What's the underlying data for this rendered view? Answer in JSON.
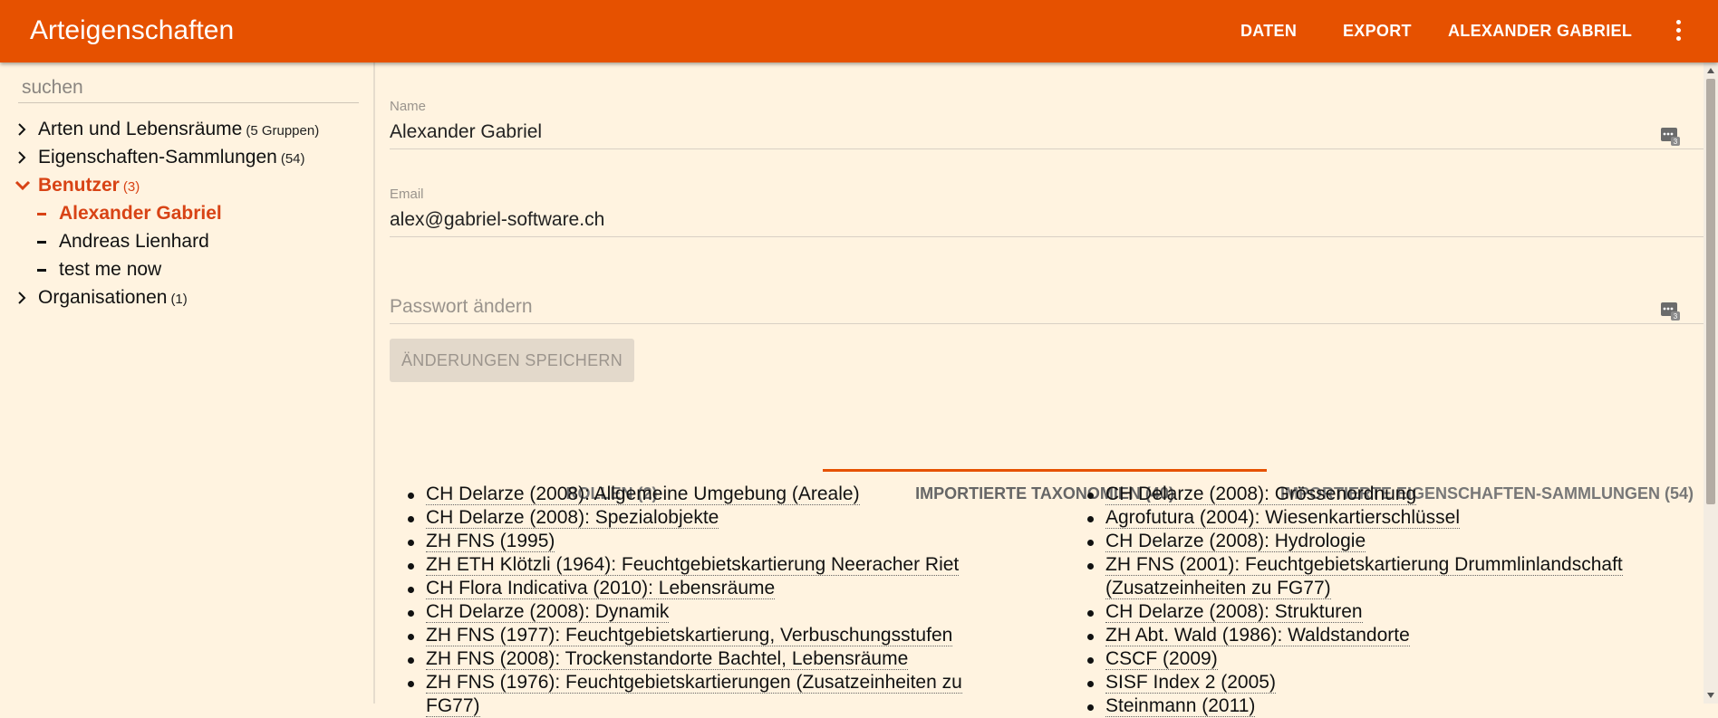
{
  "appbar": {
    "title": "Arteigenschaften",
    "nav": [
      "DATEN",
      "EXPORT",
      "ALEXANDER GABRIEL"
    ],
    "more_icon": "more-vert-icon"
  },
  "sidebar": {
    "search_placeholder": "suchen",
    "tree": [
      {
        "label": "Arten und Lebensräume",
        "count": "(5 Gruppen)",
        "icon": "chevron-right-icon"
      },
      {
        "label": "Eigenschaften-Sammlungen",
        "count": "(54)",
        "icon": "chevron-right-icon"
      },
      {
        "label": "Benutzer",
        "count": "(3)",
        "icon": "chevron-down-icon",
        "active": true
      },
      {
        "label": "Alexander Gabriel",
        "icon": "dash-icon",
        "active": true
      },
      {
        "label": "Andreas Lienhard",
        "icon": "dash-icon"
      },
      {
        "label": "test me now",
        "icon": "dash-icon"
      },
      {
        "label": "Organisationen",
        "count": "(1)",
        "icon": "chevron-right-icon"
      }
    ]
  },
  "form": {
    "name_label": "Name",
    "name_value": "Alexander Gabriel",
    "email_label": "Email",
    "email_value": "alex@gabriel-software.ch",
    "password_placeholder": "Passwort ändern",
    "save_label": "ÄNDERUNGEN SPEICHERN"
  },
  "tabs": [
    {
      "label": "ROLLEN (2)"
    },
    {
      "label": "IMPORTIERTE TAXONOMIEN (40)",
      "selected": true
    },
    {
      "label": "IMPORTIERTE EIGENSCHAFTEN-SAMMLUNGEN (54)"
    }
  ],
  "taxonomies_left": [
    "CH Delarze (2008): Allgemeine Umgebung (Areale)",
    "CH Delarze (2008): Spezialobjekte",
    "ZH FNS (1995)",
    "ZH ETH Klötzli (1964): Feuchtgebietskartierung Neeracher Riet",
    "CH Flora Indicativa (2010): Lebensräume",
    "CH Delarze (2008): Dynamik",
    "ZH FNS (1977): Feuchtgebietskartierung, Verbuschungsstufen",
    "ZH FNS (2008): Trockenstandorte Bachtel, Lebensräume",
    "ZH FNS (1976): Feuchtgebietskartierungen (Zusatzeinheiten zu FG77)"
  ],
  "taxonomies_right": [
    "CH Delarze (2008): Grössenordnung",
    "Agrofutura (2004): Wiesenkartierschlüssel",
    "CH Delarze (2008): Hydrologie",
    "ZH FNS (2001): Feuchtgebietskartierung Drummlinlandschaft (Zusatzeinheiten zu FG77)",
    "CH Delarze (2008): Strukturen",
    "ZH Abt. Wald (1986): Waldstandorte",
    "CSCF (2009)",
    "SISF Index 2 (2005)",
    "Steinmann (2011)"
  ],
  "colors": {
    "primary": "#e65100",
    "active": "#d84315",
    "background": "#fff3e0"
  }
}
